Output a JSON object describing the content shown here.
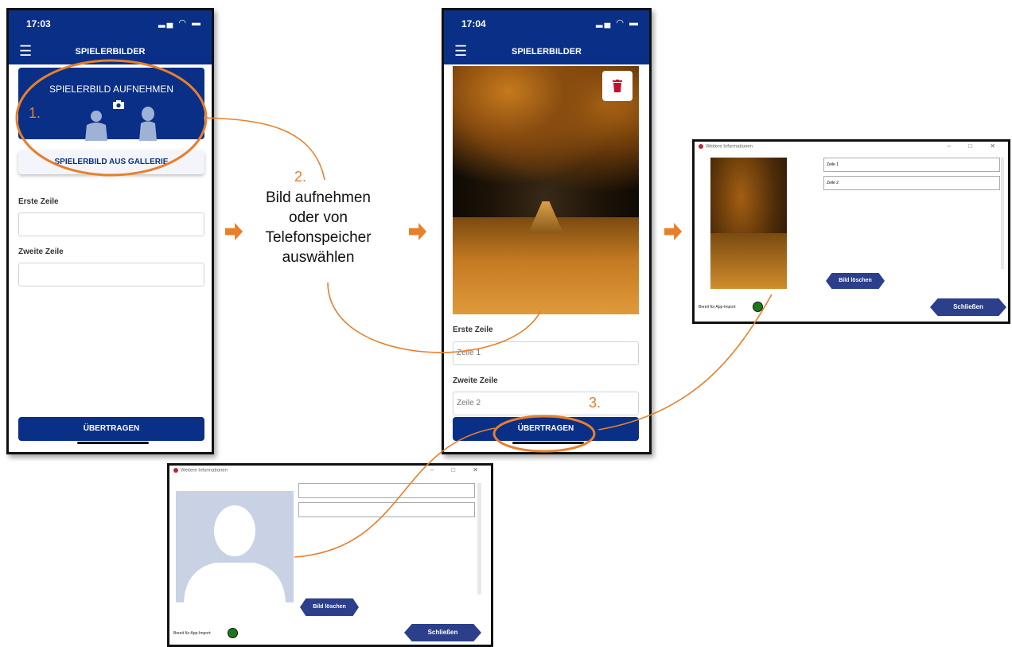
{
  "phone1": {
    "time": "17:03",
    "title": "SPIELERBILDER",
    "capture_label": "SPIELERBILD AUFNEHMEN",
    "gallery_label": "SPIELERBILD AUS GALLERIE",
    "line1_label": "Erste Zeile",
    "line1_value": "",
    "line2_label": "Zweite Zeile",
    "line2_value": "",
    "submit_label": "ÜBERTRAGEN"
  },
  "phone2": {
    "time": "17:04",
    "title": "SPIELERBILDER",
    "line1_label": "Erste Zeile",
    "line1_placeholder": "Zeile 1",
    "line2_label": "Zweite Zeile",
    "line2_placeholder": "Zeile 2",
    "submit_label": "ÜBERTRAGEN"
  },
  "steps": {
    "step1": "1.",
    "step2": "2.",
    "step3": "3.",
    "step2_line1": "Bild aufnehmen",
    "step2_line2": "oder von",
    "step2_line3": "Telefonspeicher",
    "step2_line4": "auswählen"
  },
  "dialog_right": {
    "title": "Weitere Informationen",
    "line1": "Zeile 1",
    "line2": "Zeile 2",
    "delete_label": "Bild löschen",
    "ready_label": "Bereit für App-Import:",
    "close_label": "Schließen"
  },
  "dialog_bottom": {
    "title": "Weitere Informationen",
    "line1": "",
    "line2": "",
    "delete_label": "Bild löschen",
    "ready_label": "Bereit für App-Import:",
    "close_label": "Schließen"
  },
  "colors": {
    "primary": "#0a2f86",
    "accent": "#e87f2a",
    "ready_led": "#1a7a1a",
    "delete_red": "#c8102e"
  },
  "icons": {
    "menu": "☰",
    "camera": "📷",
    "window_controls": "– □ ✕"
  }
}
